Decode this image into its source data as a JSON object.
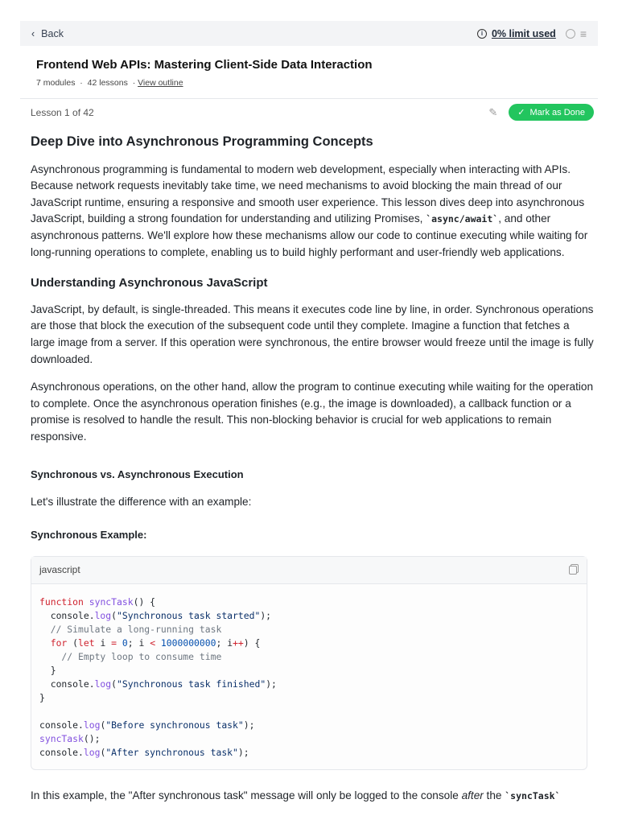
{
  "topbar": {
    "back": "Back",
    "limit": "0% limit used"
  },
  "course": {
    "title": "Frontend Web APIs: Mastering Client-Side Data Interaction",
    "modules": "7 modules",
    "lessons": "42 lessons",
    "outline": "View outline",
    "sep": "·"
  },
  "lesson": {
    "counter": "Lesson 1 of 42",
    "done": "Mark as Done"
  },
  "content": {
    "h1": "Deep Dive into Asynchronous Programming Concepts",
    "p1a": "Asynchronous programming is fundamental to modern web development, especially when interacting with APIs. Because network requests inevitably take time, we need mechanisms to avoid blocking the main thread of our JavaScript runtime, ensuring a responsive and smooth user experience. This lesson dives deep into asynchronous JavaScript, building a strong foundation for understanding and utilizing Promises, ",
    "p1code": "`async/await`",
    "p1b": ", and other asynchronous patterns. We'll explore how these mechanisms allow our code to continue executing while waiting for long-running operations to complete, enabling us to build highly performant and user-friendly web applications.",
    "h2": "Understanding Asynchronous JavaScript",
    "p2": "JavaScript, by default, is single-threaded. This means it executes code line by line, in order. Synchronous operations are those that block the execution of the subsequent code until they complete. Imagine a function that fetches a large image from a server. If this operation were synchronous, the entire browser would freeze until the image is fully downloaded.",
    "p3": "Asynchronous operations, on the other hand, allow the program to continue executing while waiting for the operation to complete. Once the asynchronous operation finishes (e.g., the image is downloaded), a callback function or a promise is resolved to handle the result. This non-blocking behavior is crucial for web applications to remain responsive.",
    "h3": "Synchronous vs. Asynchronous Execution",
    "p4": "Let's illustrate the difference with an example:",
    "h4": "Synchronous Example:",
    "code_lang": "javascript",
    "code": [
      [
        [
          "function ",
          "kw"
        ],
        [
          "syncTask",
          "fn"
        ],
        [
          "() {",
          ""
        ]
      ],
      [
        [
          "  console.",
          ""
        ],
        [
          "log",
          "fn"
        ],
        [
          "(",
          ""
        ],
        [
          "\"Synchronous task started\"",
          "st"
        ],
        [
          ");",
          ""
        ]
      ],
      [
        [
          "  // Simulate a long-running task",
          "cm"
        ]
      ],
      [
        [
          "  for ",
          "kw"
        ],
        [
          "(",
          ""
        ],
        [
          "let ",
          "kw"
        ],
        [
          "i ",
          ""
        ],
        [
          "= ",
          "kw"
        ],
        [
          "0",
          "nu"
        ],
        [
          "; i ",
          ""
        ],
        [
          "< ",
          "kw"
        ],
        [
          "1000000000",
          "nu"
        ],
        [
          "; i",
          ""
        ],
        [
          "++",
          "kw"
        ],
        [
          ") {",
          ""
        ]
      ],
      [
        [
          "    // Empty loop to consume time",
          "cm"
        ]
      ],
      [
        [
          "  }",
          ""
        ]
      ],
      [
        [
          "  console.",
          ""
        ],
        [
          "log",
          "fn"
        ],
        [
          "(",
          ""
        ],
        [
          "\"Synchronous task finished\"",
          "st"
        ],
        [
          ");",
          ""
        ]
      ],
      [
        [
          "}",
          ""
        ]
      ],
      [
        [
          "",
          ""
        ]
      ],
      [
        [
          "console.",
          ""
        ],
        [
          "log",
          "fn"
        ],
        [
          "(",
          ""
        ],
        [
          "\"Before synchronous task\"",
          "st"
        ],
        [
          ");",
          ""
        ]
      ],
      [
        [
          "syncTask",
          "fn"
        ],
        [
          "();",
          ""
        ]
      ],
      [
        [
          "console.",
          ""
        ],
        [
          "log",
          "fn"
        ],
        [
          "(",
          ""
        ],
        [
          "\"After synchronous task\"",
          "st"
        ],
        [
          ");",
          ""
        ]
      ]
    ],
    "p5a": "In this example, the \"After synchronous task\" message will only be logged to the console ",
    "p5em": "after",
    "p5b": " the ",
    "p5code": "`syncTask`"
  }
}
